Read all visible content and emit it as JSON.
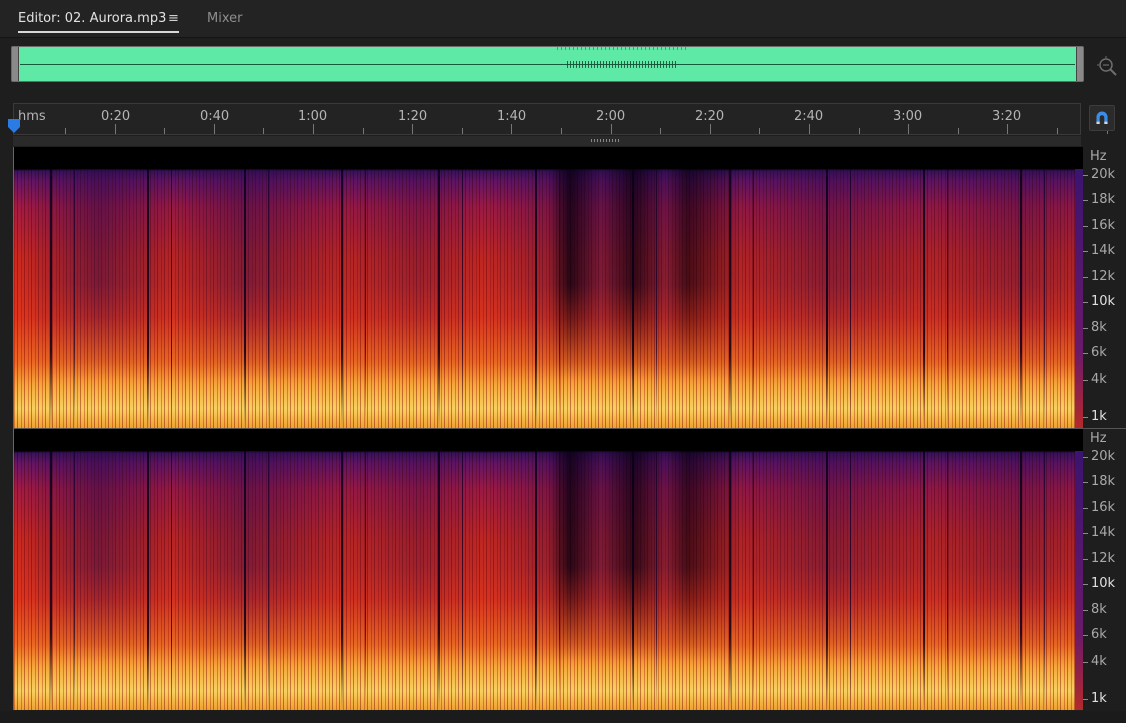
{
  "tabs": {
    "editor_label": "Editor: 02. Aurora.mp3",
    "menu_glyph": "≡",
    "mixer_label": "Mixer"
  },
  "overview": {
    "waveform_color": "#5eeaa6"
  },
  "ruler": {
    "unit_label": "hms",
    "time_labels": [
      "0:20",
      "0:40",
      "1:00",
      "1:20",
      "1:40",
      "2:00",
      "2:20",
      "2:40",
      "3:00",
      "3:20"
    ]
  },
  "frequency_axis": {
    "unit": "Hz",
    "labels": [
      "20k",
      "18k",
      "16k",
      "14k",
      "12k",
      "10k",
      "8k",
      "6k",
      "4k",
      "1k"
    ]
  },
  "colors": {
    "accent": "#2a7be4",
    "spectrum_low": "#f8d060",
    "spectrum_mid": "#e0261e",
    "spectrum_high": "#3a1470"
  },
  "icons": [
    "zoom-icon",
    "playhead-icon",
    "snap-icon",
    "menu-icon"
  ]
}
